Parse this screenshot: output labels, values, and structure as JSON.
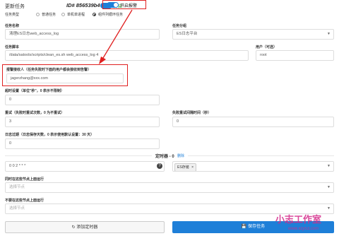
{
  "header": {
    "title": "更新任务",
    "id_label": "ID# 856539b4",
    "enable_label": "开启",
    "alarm_label": "开启报警"
  },
  "task_type": {
    "label": "任务类型",
    "options": [
      "普通任务",
      "单机单进程",
      "组件列循环任务"
    ]
  },
  "task_name": {
    "label": "任务名称",
    "value": "清理ES日志web_access_log"
  },
  "task_group": {
    "label": "任务分组",
    "value": "ES日志平台"
  },
  "task_script": {
    "label": "任务脚本",
    "value": "/data/satools/scripts/clean_es.sh web_access_log 4"
  },
  "user": {
    "label": "用户（可选）",
    "value": "root"
  },
  "alarm_receiver": {
    "label": "报警接收人（任务失败时下面的用户都会接收到告警）",
    "value": "jagerzhang@xxx.com"
  },
  "timeout": {
    "label": "超时设置（单位\"秒\"，0 表示不限制）",
    "value": "0"
  },
  "retry": {
    "label": "重试（失败时重试次数，0 为不重试）",
    "value": "3"
  },
  "retry_interval": {
    "label": "失败重试间隔时间（秒）",
    "value": "0"
  },
  "log_expire": {
    "label": "日志过期（日志保存天数，0 表示使用默认设置：30 天）",
    "value": "0"
  },
  "timers": {
    "title": "定时器 - 0",
    "delete_label": "删除",
    "cron_value": "0 0 2 * * *",
    "node_tag": "ES存储",
    "node_tag_close": "×"
  },
  "run_nodes": {
    "label": "同时在这些节点上面运行",
    "placeholder": "选择节点"
  },
  "exclude_nodes": {
    "label": "不要在这些节点上面运行",
    "placeholder": "选择节点"
  },
  "buttons": {
    "add_timer": "添加定时器",
    "save": "保存任务"
  },
  "watermark": {
    "text": "小志工作室",
    "url": "www.xzy53.com"
  },
  "colors": {
    "accent": "#1e7fd8",
    "highlight": "#e02020",
    "watermark": "#d42a8a"
  }
}
